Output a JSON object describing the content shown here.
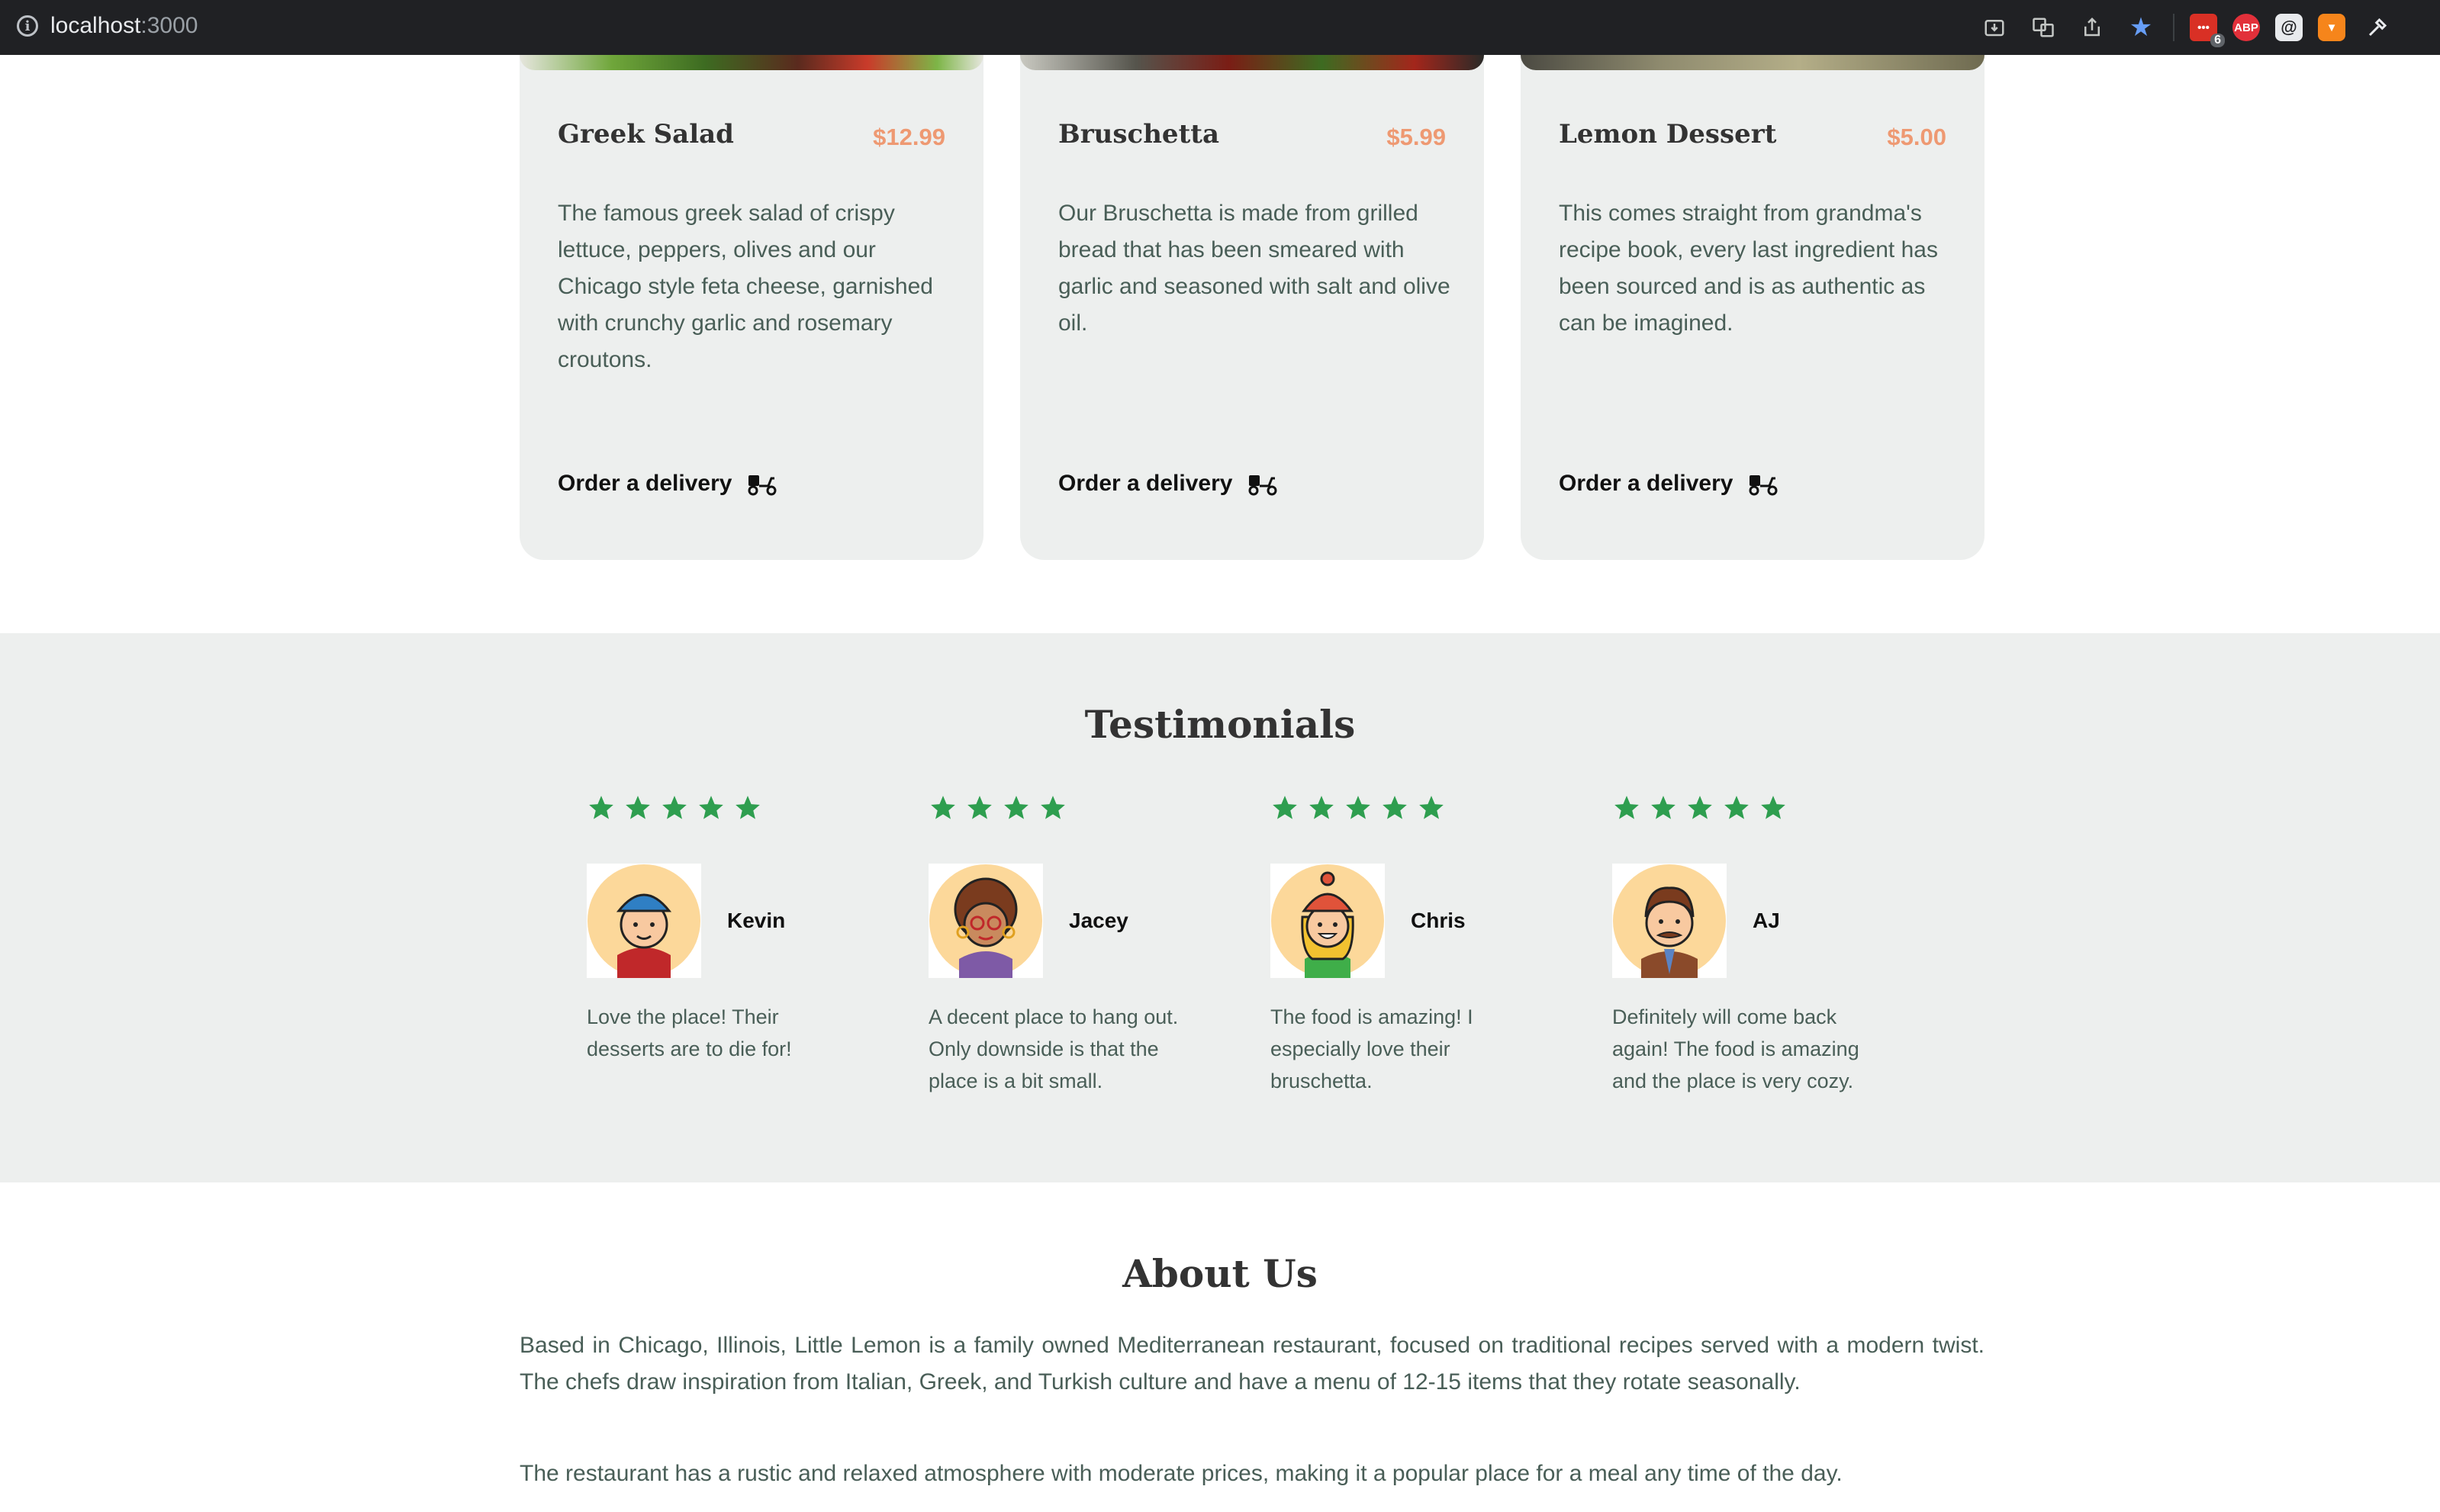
{
  "browser": {
    "host": "localhost",
    "port": ":3000",
    "ext_badge": "6",
    "ext_abp": "ABP"
  },
  "menu": {
    "order_label": "Order a delivery",
    "items": [
      {
        "title": "Greek Salad",
        "price": "$12.99",
        "description": "The famous greek salad of crispy lettuce, peppers, olives and our Chicago style feta cheese, garnished with crunchy garlic and rosemary croutons."
      },
      {
        "title": "Bruschetta",
        "price": "$5.99",
        "description": "Our Bruschetta is made from grilled bread that has been smeared with garlic and seasoned with salt and olive oil."
      },
      {
        "title": "Lemon Dessert",
        "price": "$5.00",
        "description": "This comes straight from grandma's recipe book, every last ingredient has been sourced and is as authentic as can be imagined."
      }
    ]
  },
  "testimonials": {
    "title": "Testimonials",
    "star_color": "#2e9e4f",
    "items": [
      {
        "name": "Kevin",
        "rating": 5,
        "review": "Love the place! Their desserts are to die for!"
      },
      {
        "name": "Jacey",
        "rating": 4,
        "review": "A decent place to hang out. Only downside is that the place is a bit small."
      },
      {
        "name": "Chris",
        "rating": 5,
        "review": "The food is amazing! I especially love their bruschetta."
      },
      {
        "name": "AJ",
        "rating": 5,
        "review": "Definitely will come back again! The food is amazing and the place is very cozy."
      }
    ]
  },
  "about": {
    "title": "About Us",
    "paragraphs": [
      "Based in Chicago, Illinois, Little Lemon is a family owned Mediterranean restaurant, focused on traditional recipes served with a modern twist. The chefs draw inspiration from Italian, Greek, and Turkish culture and have a menu of 12-15 items that they rotate seasonally.",
      "The restaurant has a rustic and relaxed atmosphere with moderate prices, making it a popular place for a meal any time of the day."
    ]
  }
}
